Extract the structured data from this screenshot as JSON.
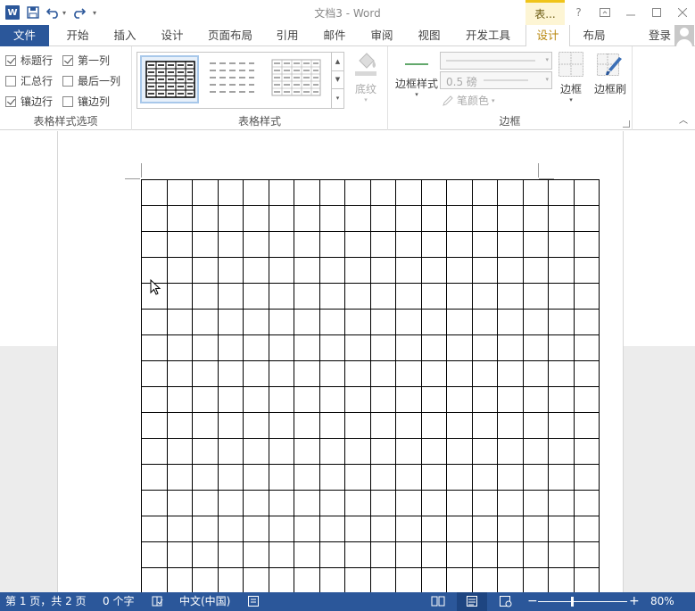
{
  "titlebar": {
    "logo_letter": "W",
    "title": "文档3 - Word",
    "context_tab_group": "表...",
    "help": "?"
  },
  "tabs": [
    {
      "label": "文件",
      "kind": "file"
    },
    {
      "label": "开始"
    },
    {
      "label": "插入"
    },
    {
      "label": "设计"
    },
    {
      "label": "页面布局"
    },
    {
      "label": "引用"
    },
    {
      "label": "邮件"
    },
    {
      "label": "审阅"
    },
    {
      "label": "视图"
    },
    {
      "label": "开发工具"
    },
    {
      "label": "设计",
      "kind": "context",
      "active": true
    },
    {
      "label": "布局",
      "kind": "context"
    }
  ],
  "account": {
    "login_label": "登录"
  },
  "ribbon": {
    "style_options": {
      "group_label": "表格样式选项",
      "checkboxes": [
        {
          "label": "标题行",
          "checked": true
        },
        {
          "label": "第一列",
          "checked": true
        },
        {
          "label": "汇总行",
          "checked": false
        },
        {
          "label": "最后一列",
          "checked": false
        },
        {
          "label": "镶边行",
          "checked": true
        },
        {
          "label": "镶边列",
          "checked": false
        }
      ]
    },
    "table_styles": {
      "group_label": "表格样式",
      "shading_label": "底纹"
    },
    "borders": {
      "group_label": "边框",
      "border_style_label": "边框样式",
      "weight_value": "0.5 磅",
      "pen_color_label": "笔颜色",
      "borders_label": "边框",
      "painter_label": "边框刷"
    }
  },
  "document": {
    "table_rows": 16,
    "table_cols": 18
  },
  "statusbar": {
    "page_info": "第 1 页，共 2 页",
    "word_count": "0 个字",
    "language": "中文(中国)",
    "zoom": "80%"
  },
  "colors": {
    "accent": "#2b579a",
    "context_tab": "#f0c419"
  }
}
